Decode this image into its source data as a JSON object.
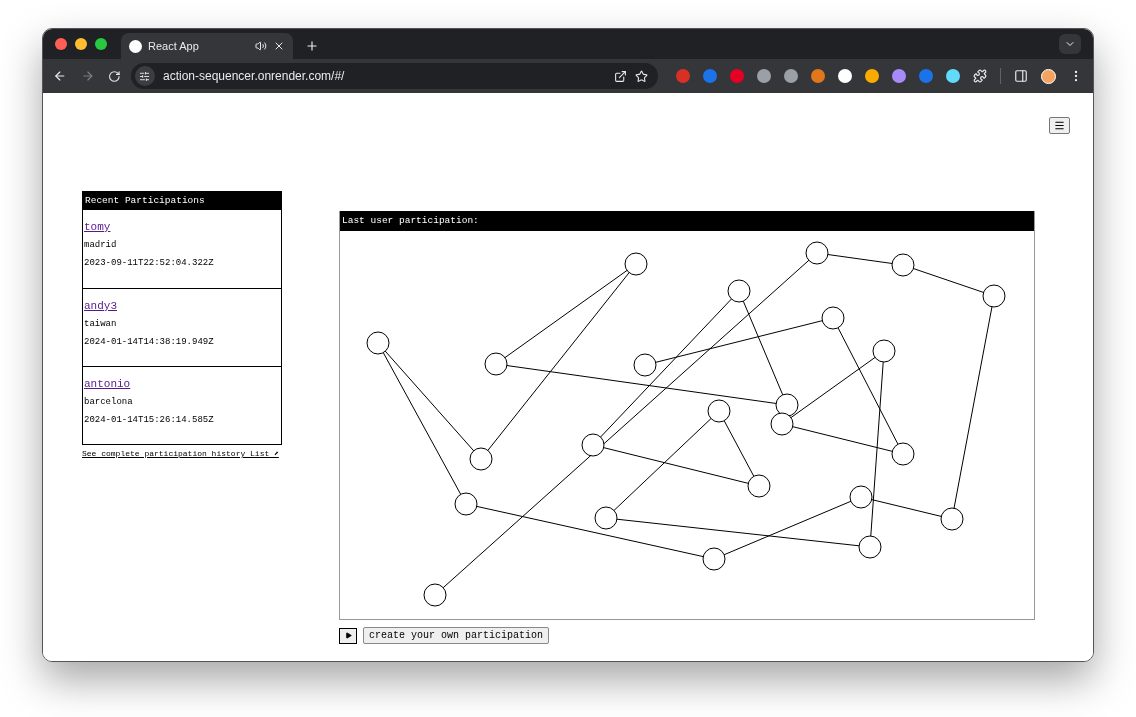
{
  "browser": {
    "tab": {
      "title": "React App"
    },
    "url": "action-sequencer.onrender.com/#/"
  },
  "recent_participations": {
    "title": "Recent Participations",
    "items": [
      {
        "name": "tomy",
        "city": "madrid",
        "timestamp": "2023-09-11T22:52:04.322Z"
      },
      {
        "name": "andy3",
        "city": "taiwan",
        "timestamp": "2024-01-14T14:38:19.949Z"
      },
      {
        "name": "antonio",
        "city": "barcelona",
        "timestamp": "2024-01-14T15:26:14.585Z"
      }
    ],
    "history_link": "See complete participation history List ⬈"
  },
  "last_participation": {
    "title": "Last user participation:"
  },
  "create_button": {
    "label": "create your own participation"
  }
}
